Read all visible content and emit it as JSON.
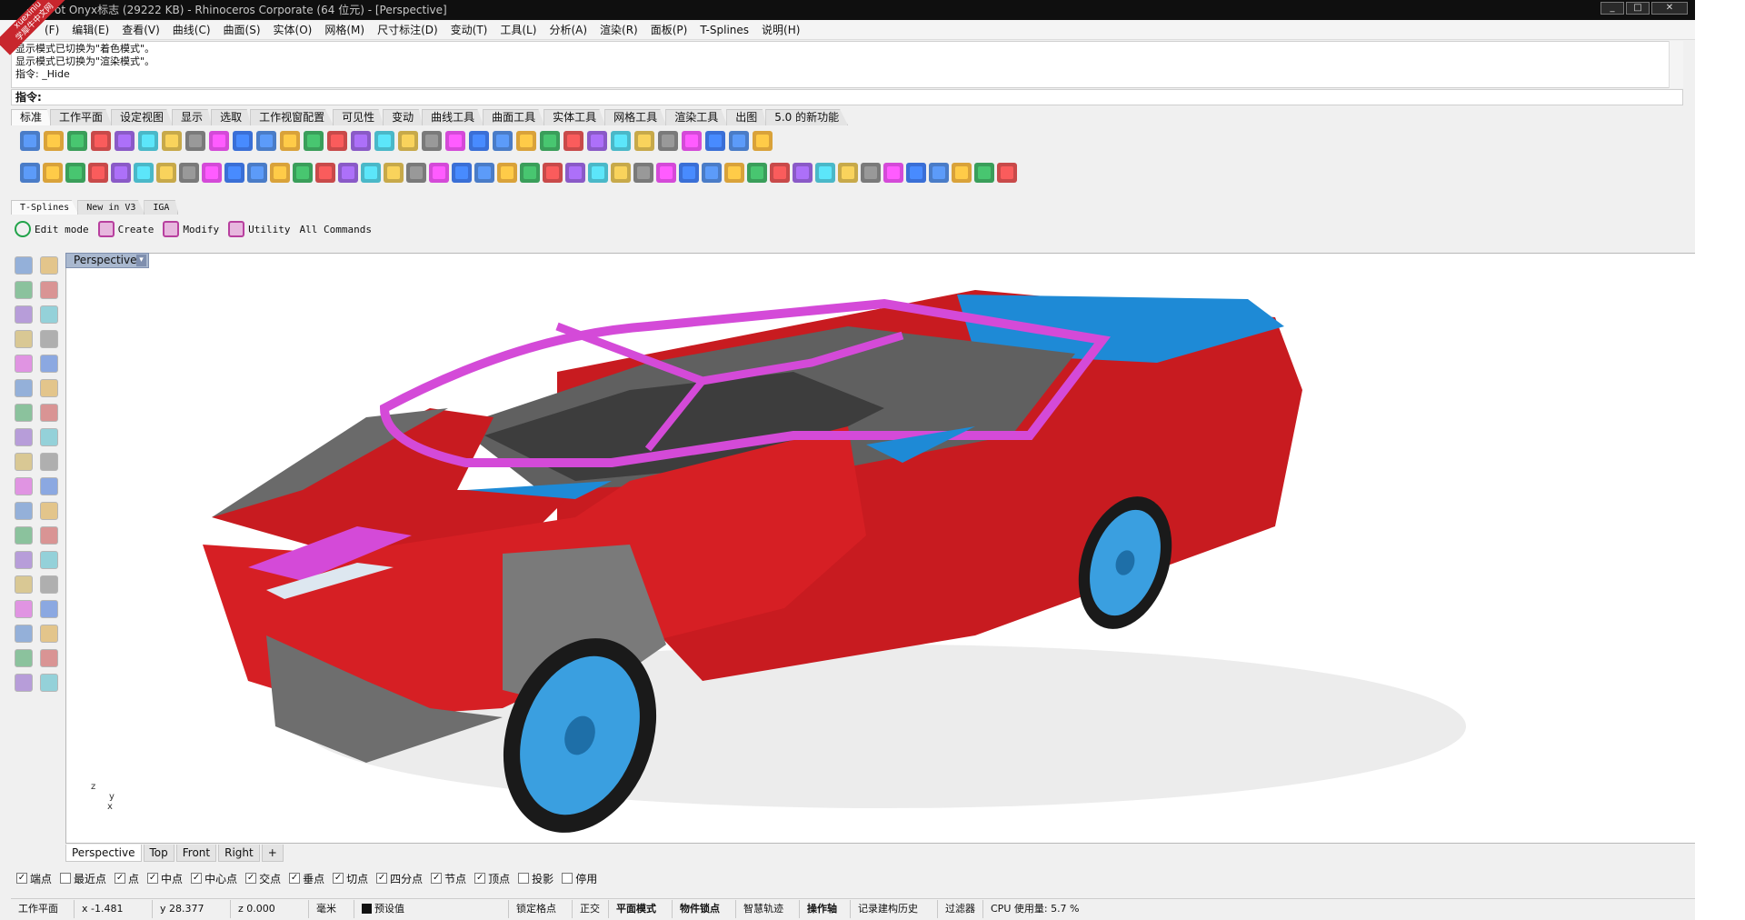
{
  "window": {
    "title": "ot Onyx标志 (29222 KB) - Rhinoceros Corporate (64 位元) - [Perspective]",
    "minimize": "_",
    "maximize": "□",
    "close": "✕"
  },
  "watermark": {
    "line1": "xuexiniu",
    "line2": "学犀牛中文网"
  },
  "menu": [
    "(F)",
    "编辑(E)",
    "查看(V)",
    "曲线(C)",
    "曲面(S)",
    "实体(O)",
    "网格(M)",
    "尺寸标注(D)",
    "变动(T)",
    "工具(L)",
    "分析(A)",
    "渲染(R)",
    "面板(P)",
    "T-Splines",
    "说明(H)"
  ],
  "history": [
    "显示模式已切换为\"着色模式\"。",
    "显示模式已切换为\"渲染模式\"。",
    "指令: _Hide"
  ],
  "command": {
    "label": "指令:",
    "value": ""
  },
  "toolbar_tabs": [
    "标准",
    "工作平面",
    "设定视图",
    "显示",
    "选取",
    "工作视窗配置",
    "可见性",
    "变动",
    "曲线工具",
    "曲面工具",
    "实体工具",
    "网格工具",
    "渲染工具",
    "出图",
    "5.0 的新功能"
  ],
  "toolbar_row1_icons": [
    "new-icon",
    "open-icon",
    "save-icon",
    "print-icon",
    "import-icon",
    "cut-icon",
    "copy-icon",
    "paste-icon",
    "undo-icon",
    "pan-icon",
    "move-icon",
    "zoom-icon",
    "zoom-window-icon",
    "zoom-extents-icon",
    "zoom-selected-icon",
    "rotate-view-icon",
    "four-view-icon",
    "car-icon",
    "grid-icon",
    "snap-icon",
    "layer-icon",
    "light-icon",
    "lock-icon",
    "material-icon",
    "color-wheel-icon",
    "shade-icon",
    "render-icon",
    "sphere-icon",
    "options-icon",
    "rebuild-icon",
    "filter-icon",
    "help-icon"
  ],
  "toolbar_row2_icons": [
    "power-icon",
    "box-edit-icon",
    "sphere-edit-icon",
    "tool-a-icon",
    "tool-b-icon",
    "tool-c-icon",
    "tool-d-icon",
    "tool-e-icon",
    "tool-f-icon",
    "tool-g-icon",
    "tool-h-icon",
    "tool-i-icon",
    "tool-j-icon",
    "tool-k-icon",
    "tool-l-icon",
    "tool-m-icon",
    "tool-n-icon",
    "tool-o-icon",
    "tool-p-icon",
    "tool-q-icon",
    "tool-r-icon",
    "tool-s-icon",
    "tool-t-icon",
    "tool-u-icon",
    "tool-v-icon",
    "tool-w-icon",
    "tool-x-icon",
    "tool-y-icon",
    "tool-z-icon",
    "tool-aa-icon",
    "tool-ab-icon",
    "tool-ac-icon",
    "tool-ad-icon",
    "tool-ae-icon",
    "tool-af-icon",
    "tool-ag-icon",
    "tool-ah-icon",
    "tool-ai-icon",
    "tool-aj-icon",
    "tool-ak-icon",
    "tool-al-icon",
    "tool-am-icon",
    "tool-an-icon",
    "tool-ao-icon"
  ],
  "tsplines_tabs": [
    "T-Splines",
    "New in V3",
    "IGA"
  ],
  "tsplines_buttons": [
    "Edit mode",
    "Create",
    "Modify",
    "Utility",
    "All Commands"
  ],
  "viewport": {
    "label": "Perspective",
    "menu_arrow": "▾"
  },
  "axes": {
    "z": "z",
    "y": "y",
    "x": "x"
  },
  "view_tabs": [
    "Perspective",
    "Top",
    "Front",
    "Right",
    "+"
  ],
  "osnaps": [
    {
      "label": "端点",
      "checked": true
    },
    {
      "label": "最近点",
      "checked": false
    },
    {
      "label": "点",
      "checked": true
    },
    {
      "label": "中点",
      "checked": true
    },
    {
      "label": "中心点",
      "checked": true
    },
    {
      "label": "交点",
      "checked": true
    },
    {
      "label": "垂点",
      "checked": true
    },
    {
      "label": "切点",
      "checked": true
    },
    {
      "label": "四分点",
      "checked": true
    },
    {
      "label": "节点",
      "checked": true
    },
    {
      "label": "顶点",
      "checked": true
    },
    {
      "label": "投影",
      "checked": false
    },
    {
      "label": "停用",
      "checked": false
    }
  ],
  "status": {
    "cplane": "工作平面",
    "x": "x -1.481",
    "y": "y 28.377",
    "z": "z 0.000",
    "unit": "毫米",
    "layer": "预设值",
    "grid_snap": "锁定格点",
    "ortho": "正交",
    "planar": "平面模式",
    "osnap": "物件锁点",
    "smart_track": "智慧轨迹",
    "gumball": "操作轴",
    "history": "记录建构历史",
    "filter": "过滤器",
    "cpu": "CPU 使用量: 5.7 %"
  },
  "colors": {
    "body_red": "#d61f24",
    "trim_gray": "#6e6e6e",
    "cage_magenta": "#d44ad8",
    "wheel_blue": "#3a9fe0",
    "accent_blue": "#1e8ad6"
  }
}
